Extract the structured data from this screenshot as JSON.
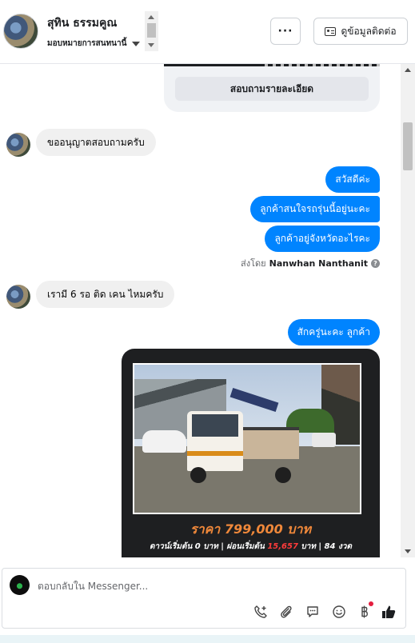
{
  "header": {
    "name": "สุทิน ธรรมคูณ",
    "assign_label": "มอบหมายการสนทนานี้",
    "more_label": "···",
    "contact_label": "ดูข้อมูลติดต่อ"
  },
  "prev_card": {
    "button_label": "สอบถามรายละเอียด"
  },
  "messages": {
    "in1": "ขออนุญาตสอบถามครับ",
    "out1": "สวัสดีค่ะ",
    "out2": "ลูกค้าสนใจรถรุ่นนี้อยู่นะคะ",
    "out3": "ลูกค้าอยู่จังหวัดอะไรคะ",
    "sent_by_prefix": "ส่งโดย",
    "sent_by_name": "Nanwhan Nanthanit",
    "in2": "เรามี 6 รอ ติด เคน ไหมครับ",
    "out4": "สักครู่นะคะ ลูกค้า"
  },
  "product_card": {
    "price_text": "ราคา 799,000 บาท",
    "terms_prefix": "ดาวน์เริ่มต้น 0 บาท | ผ่อนเริ่มต้น",
    "terms_accent": "15,657",
    "terms_suffix": "บาท | 84 งวด"
  },
  "composer": {
    "placeholder": "ตอบกลับใน Messenger..."
  },
  "icons": {
    "call": "phone-plus-icon",
    "attach": "paperclip-icon",
    "chat": "chat-bubble-icon",
    "emoji": "emoji-icon",
    "baht": "baht-icon",
    "like": "thumbs-up-icon"
  },
  "colors": {
    "outgoing_bubble": "#0084ff",
    "incoming_bubble": "#f0f0f0",
    "price_accent": "#f0883a",
    "installment_accent": "#ff3b3b"
  }
}
